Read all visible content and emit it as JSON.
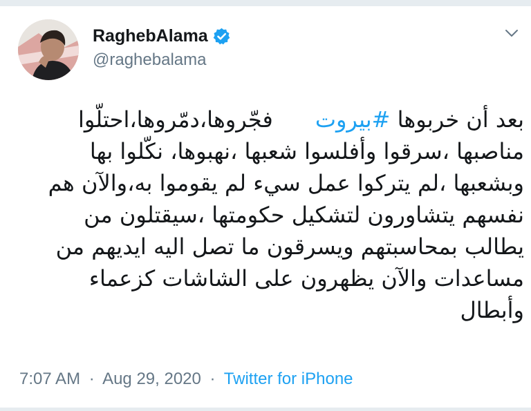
{
  "author": {
    "display_name": "RaghebAlama",
    "handle": "@raghebalama",
    "verified": true
  },
  "tweet": {
    "lines": [
      {
        "prefix": "بعد أن خربوها ",
        "hashtag": "#بيروت",
        "suffix": "      فجّروها،دمّروها،احتلّوا"
      },
      {
        "text": "مناصبها ،سرقوا وأفلسوا شعبها ،نهبوها،  نكّلوا بها"
      },
      {
        "text": "وبشعبها ،لم يتركوا عمل سيء لم يقوموا به،والآن هم"
      },
      {
        "text": "نفسهم يتشاورون لتشكيل حكومتها ،سيقتلون من"
      },
      {
        "text": "يطالب بمحاسبتهم ويسرقون ما تصل اليه ايديهم من"
      },
      {
        "text": "مساعدات والآن يظهرون على الشاشات كزعماء"
      },
      {
        "text": "وأبطال"
      }
    ]
  },
  "meta": {
    "time": "7:07 AM",
    "separator": "·",
    "date": "Aug 29, 2020",
    "source": "Twitter for iPhone"
  },
  "colors": {
    "link": "#1da1f2",
    "secondary_text": "#657786",
    "primary_text": "#14171a"
  },
  "icons": {
    "verified": "verified-badge-icon",
    "more": "chevron-down-icon"
  }
}
